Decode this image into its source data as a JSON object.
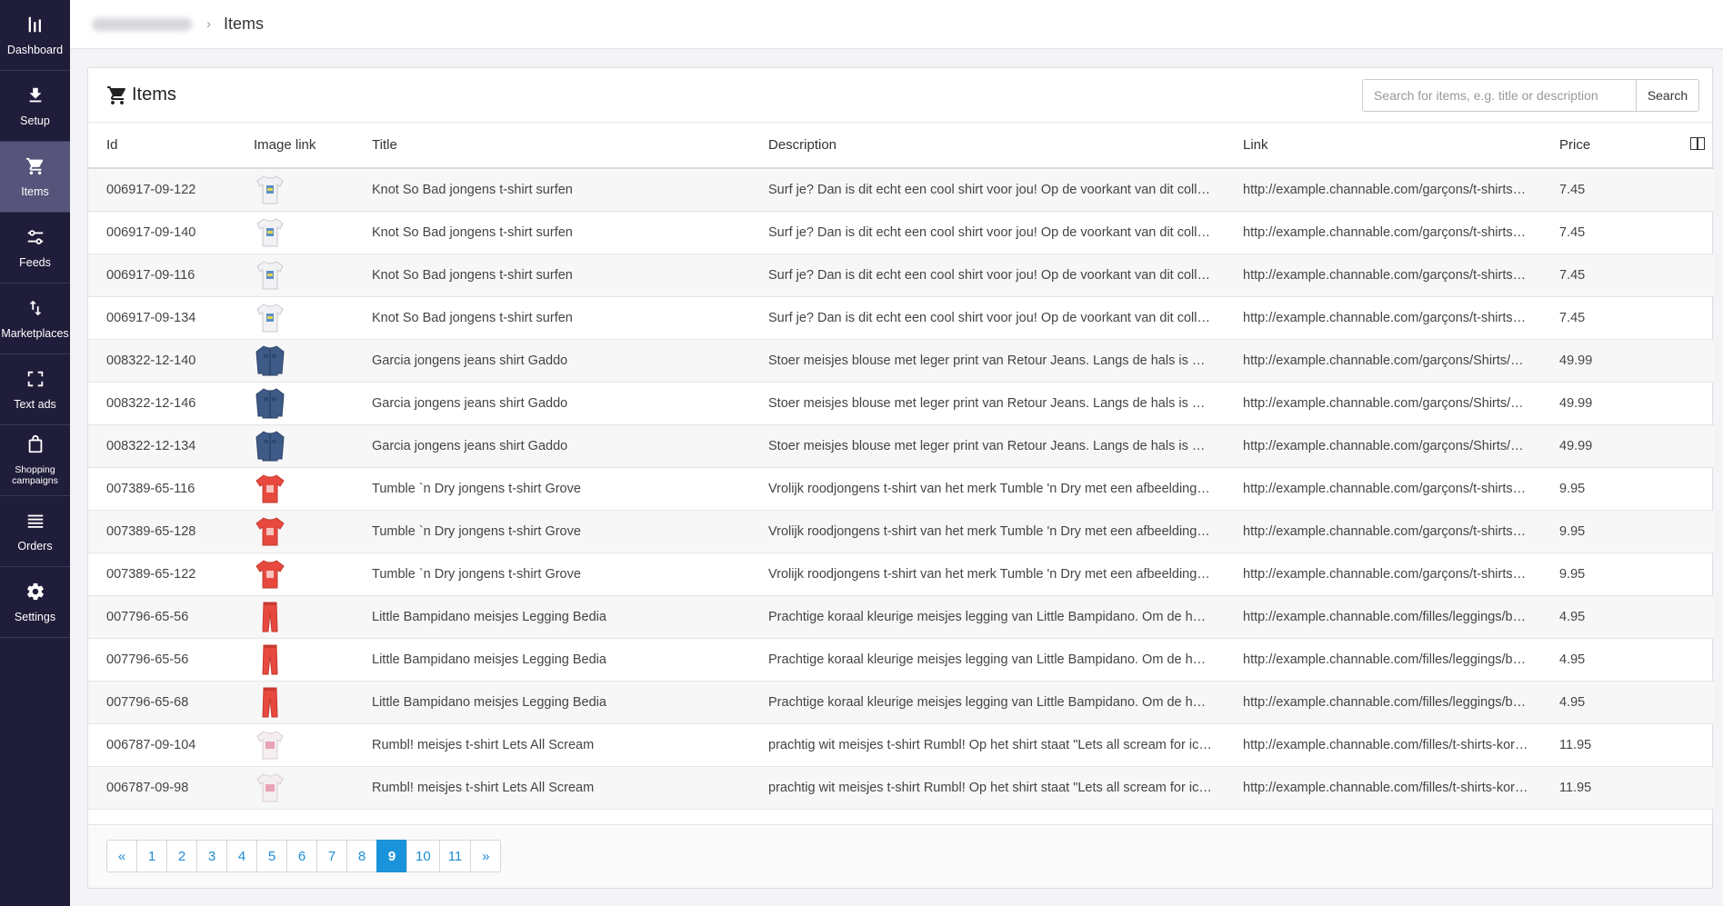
{
  "sidebar": {
    "items": [
      {
        "label": "Dashboard",
        "icon": "bar-chart-icon"
      },
      {
        "label": "Setup",
        "icon": "download-icon"
      },
      {
        "label": "Items",
        "icon": "cart-icon",
        "active": true
      },
      {
        "label": "Feeds",
        "icon": "sliders-icon"
      },
      {
        "label": "Marketplaces",
        "icon": "arrows-updown-icon"
      },
      {
        "label": "Text ads",
        "icon": "expand-icon"
      },
      {
        "label": "Shopping campaigns",
        "icon": "bag-icon"
      },
      {
        "label": "Orders",
        "icon": "list-icon"
      },
      {
        "label": "Settings",
        "icon": "gear-icon"
      }
    ]
  },
  "breadcrumb": {
    "current": "Items"
  },
  "panel": {
    "title": "Items"
  },
  "search": {
    "placeholder": "Search for items, e.g. title or description",
    "value": "",
    "button_label": "Search"
  },
  "table": {
    "headers": {
      "id": "Id",
      "image": "Image link",
      "title": "Title",
      "description": "Description",
      "link": "Link",
      "price": "Price"
    },
    "rows": [
      {
        "id": "006917-09-122",
        "image": "tshirt-white",
        "title": "Knot So Bad jongens t-shirt surfen",
        "description": "Surf je? Dan is dit echt een cool shirt voor jou! Op de voorkant van dit colle …",
        "link": "http://example.channable.com/garçons/t-shirts-…",
        "price": "7.45"
      },
      {
        "id": "006917-09-140",
        "image": "tshirt-white",
        "title": "Knot So Bad jongens t-shirt surfen",
        "description": "Surf je? Dan is dit echt een cool shirt voor jou! Op de voorkant van dit colle …",
        "link": "http://example.channable.com/garçons/t-shirts-…",
        "price": "7.45"
      },
      {
        "id": "006917-09-116",
        "image": "tshirt-white",
        "title": "Knot So Bad jongens t-shirt surfen",
        "description": "Surf je? Dan is dit echt een cool shirt voor jou! Op de voorkant van dit colle …",
        "link": "http://example.channable.com/garçons/t-shirts-…",
        "price": "7.45"
      },
      {
        "id": "006917-09-134",
        "image": "tshirt-white",
        "title": "Knot So Bad jongens t-shirt surfen",
        "description": "Surf je? Dan is dit echt een cool shirt voor jou! Op de voorkant van dit colle …",
        "link": "http://example.channable.com/garçons/t-shirts-…",
        "price": "7.45"
      },
      {
        "id": "008322-12-140",
        "image": "jeans-shirt",
        "title": "Garcia jongens jeans shirt Gaddo",
        "description": "Stoer meisjes blouse met leger print van Retour Jeans. Langs de hals is ee…",
        "link": "http://example.channable.com/garçons/Shirts/…",
        "price": "49.99"
      },
      {
        "id": "008322-12-146",
        "image": "jeans-shirt",
        "title": "Garcia jongens jeans shirt Gaddo",
        "description": "Stoer meisjes blouse met leger print van Retour Jeans. Langs de hals is ee…",
        "link": "http://example.channable.com/garçons/Shirts/…",
        "price": "49.99"
      },
      {
        "id": "008322-12-134",
        "image": "jeans-shirt",
        "title": "Garcia jongens jeans shirt Gaddo",
        "description": "Stoer meisjes blouse met leger print van Retour Jeans. Langs de hals is ee…",
        "link": "http://example.channable.com/garçons/Shirts/…",
        "price": "49.99"
      },
      {
        "id": "007389-65-116",
        "image": "tshirt-red",
        "title": "Tumble `n Dry jongens t-shirt Grove",
        "description": "Vrolijk roodjongens t-shirt van het merk Tumble 'n Dry met een afbeelding v…",
        "link": "http://example.channable.com/garçons/t-shirts-…",
        "price": "9.95"
      },
      {
        "id": "007389-65-128",
        "image": "tshirt-red",
        "title": "Tumble `n Dry jongens t-shirt Grove",
        "description": "Vrolijk roodjongens t-shirt van het merk Tumble 'n Dry met een afbeelding v…",
        "link": "http://example.channable.com/garçons/t-shirts-…",
        "price": "9.95"
      },
      {
        "id": "007389-65-122",
        "image": "tshirt-red",
        "title": "Tumble `n Dry jongens t-shirt Grove",
        "description": "Vrolijk roodjongens t-shirt van het merk Tumble 'n Dry met een afbeelding v…",
        "link": "http://example.channable.com/garçons/t-shirts-…",
        "price": "9.95"
      },
      {
        "id": "007796-65-56",
        "image": "legging-red",
        "title": "Little Bampidano meisjes Legging Bedia",
        "description": "Prachtige koraal kleurige meisjes legging van Little Bampidano. Om de heu…",
        "link": "http://example.channable.com/filles/leggings/b…",
        "price": "4.95"
      },
      {
        "id": "007796-65-56",
        "image": "legging-red",
        "title": "Little Bampidano meisjes Legging Bedia",
        "description": "Prachtige koraal kleurige meisjes legging van Little Bampidano. Om de heu…",
        "link": "http://example.channable.com/filles/leggings/b…",
        "price": "4.95"
      },
      {
        "id": "007796-65-68",
        "image": "legging-red",
        "title": "Little Bampidano meisjes Legging Bedia",
        "description": "Prachtige koraal kleurige meisjes legging van Little Bampidano. Om de heu…",
        "link": "http://example.channable.com/filles/leggings/b…",
        "price": "4.95"
      },
      {
        "id": "006787-09-104",
        "image": "tshirt-pink",
        "title": "Rumbl! meisjes t-shirt Lets All Scream",
        "description": "prachtig wit meisjes t-shirt Rumbl! Op het shirt staat \"Lets all scream for ic…",
        "link": "http://example.channable.com/filles/t-shirts-kor…",
        "price": "11.95"
      },
      {
        "id": "006787-09-98",
        "image": "tshirt-pink",
        "title": "Rumbl! meisjes t-shirt Lets All Scream",
        "description": "prachtig wit meisjes t-shirt Rumbl! Op het shirt staat \"Lets all scream for ic…",
        "link": "http://example.channable.com/filles/t-shirts-kor…",
        "price": "11.95"
      }
    ]
  },
  "pagination": {
    "prev": "«",
    "next": "»",
    "pages": [
      "1",
      "2",
      "3",
      "4",
      "5",
      "6",
      "7",
      "8",
      "9",
      "10",
      "11"
    ],
    "current": "9"
  },
  "colors": {
    "sidebar_bg": "#1f1d3a",
    "sidebar_active": "#56547a",
    "accent": "#1a93da"
  }
}
